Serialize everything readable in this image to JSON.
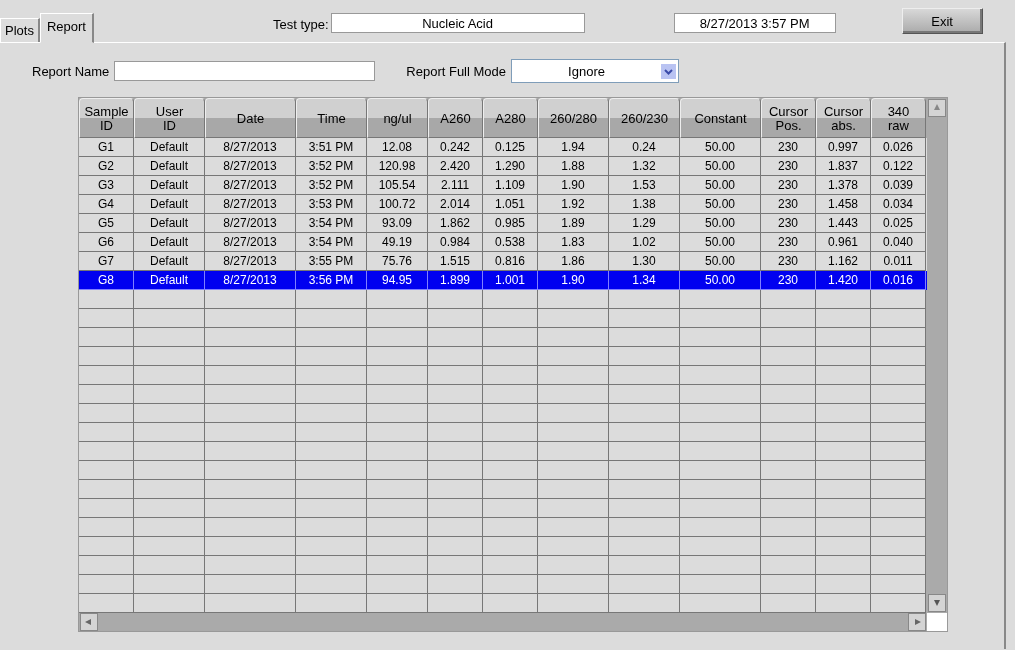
{
  "tabs": [
    {
      "label": "Plots",
      "selected": false
    },
    {
      "label": "Report",
      "selected": true
    }
  ],
  "test_type": {
    "label": "Test type:",
    "value": "Nucleic Acid"
  },
  "datetime": "8/27/2013  3:57 PM",
  "exit_button": "Exit",
  "report_name": {
    "label": "Report Name"
  },
  "report_full_mode": {
    "label": "Report Full Mode",
    "value": "Ignore"
  },
  "table": {
    "columns": [
      "Sample\nID",
      "User\nID",
      "Date",
      "Time",
      "ng/ul",
      "A260",
      "A280",
      "260/280",
      "260/230",
      "Constant",
      "Cursor\nPos.",
      "Cursor\nabs.",
      "340\nraw"
    ],
    "rows": [
      {
        "selected": false,
        "cells": [
          "G1",
          "Default",
          "8/27/2013",
          "3:51 PM",
          "12.08",
          "0.242",
          "0.125",
          "1.94",
          "0.24",
          "50.00",
          "230",
          "0.997",
          "0.026"
        ]
      },
      {
        "selected": false,
        "cells": [
          "G2",
          "Default",
          "8/27/2013",
          "3:52 PM",
          "120.98",
          "2.420",
          "1.290",
          "1.88",
          "1.32",
          "50.00",
          "230",
          "1.837",
          "0.122"
        ]
      },
      {
        "selected": false,
        "cells": [
          "G3",
          "Default",
          "8/27/2013",
          "3:52 PM",
          "105.54",
          "2.111",
          "1.109",
          "1.90",
          "1.53",
          "50.00",
          "230",
          "1.378",
          "0.039"
        ]
      },
      {
        "selected": false,
        "cells": [
          "G4",
          "Default",
          "8/27/2013",
          "3:53 PM",
          "100.72",
          "2.014",
          "1.051",
          "1.92",
          "1.38",
          "50.00",
          "230",
          "1.458",
          "0.034"
        ]
      },
      {
        "selected": false,
        "cells": [
          "G5",
          "Default",
          "8/27/2013",
          "3:54 PM",
          "93.09",
          "1.862",
          "0.985",
          "1.89",
          "1.29",
          "50.00",
          "230",
          "1.443",
          "0.025"
        ]
      },
      {
        "selected": false,
        "cells": [
          "G6",
          "Default",
          "8/27/2013",
          "3:54 PM",
          "49.19",
          "0.984",
          "0.538",
          "1.83",
          "1.02",
          "50.00",
          "230",
          "0.961",
          "0.040"
        ]
      },
      {
        "selected": false,
        "cells": [
          "G7",
          "Default",
          "8/27/2013",
          "3:55 PM",
          "75.76",
          "1.515",
          "0.816",
          "1.86",
          "1.30",
          "50.00",
          "230",
          "1.162",
          "0.011"
        ]
      },
      {
        "selected": true,
        "cells": [
          "G8",
          "Default",
          "8/27/2013",
          "3:56 PM",
          "94.95",
          "1.899",
          "1.001",
          "1.90",
          "1.34",
          "50.00",
          "230",
          "1.420",
          "0.016"
        ]
      }
    ]
  }
}
